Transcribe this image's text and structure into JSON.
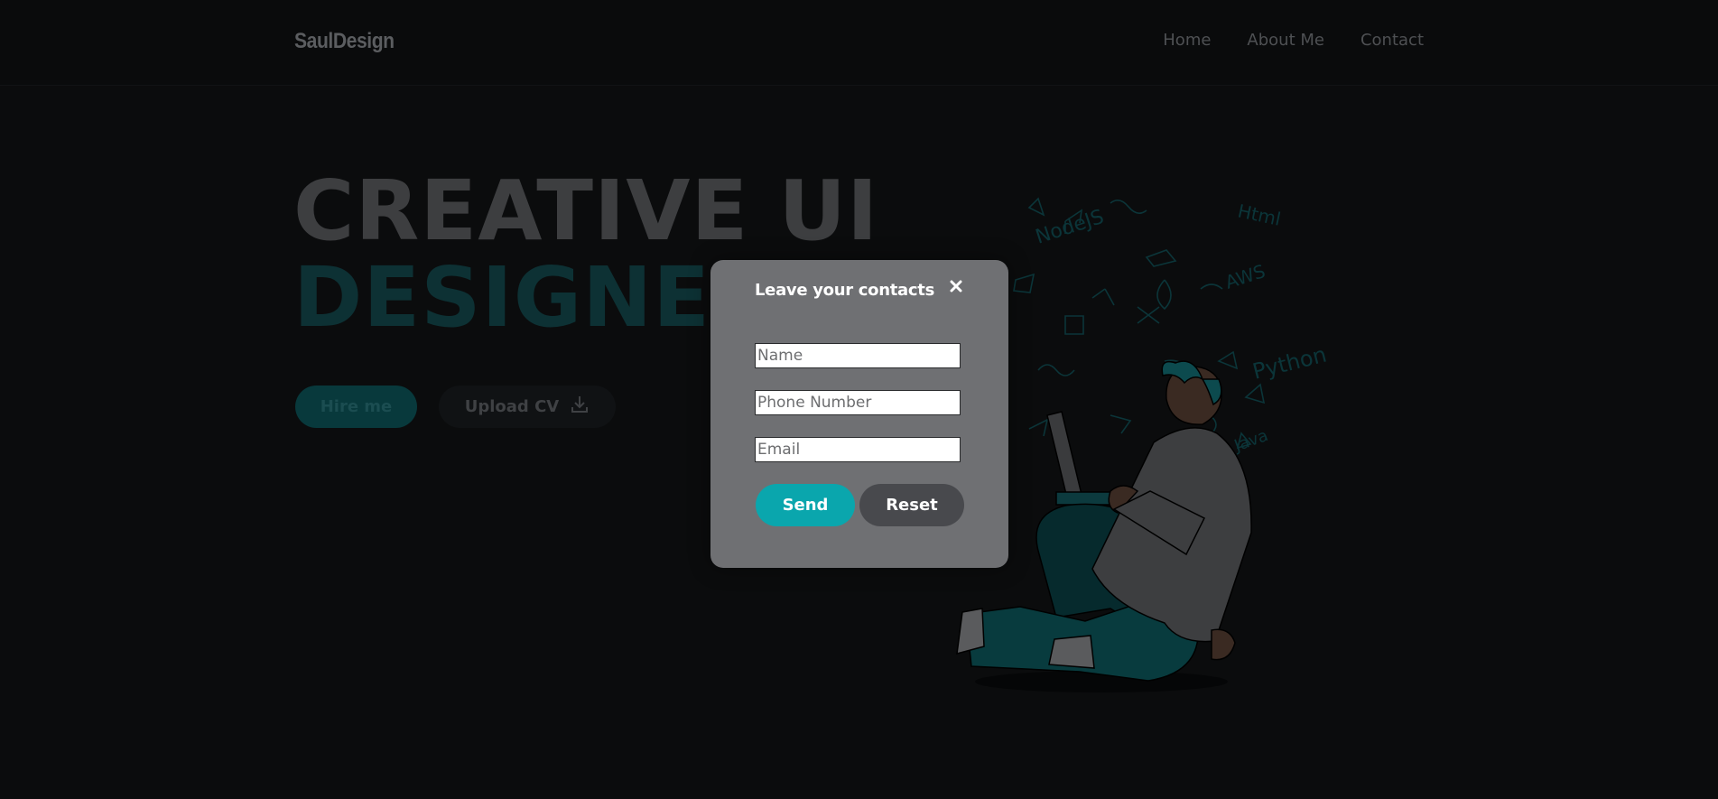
{
  "header": {
    "logo": "SaulDesign",
    "nav": [
      "Home",
      "About Me",
      "Contact"
    ]
  },
  "hero": {
    "line1": "CREATIVE UI",
    "line2": "DESIGNER",
    "hire_label": "Hire me",
    "upload_label": "Upload CV",
    "upload_icon": "download-icon"
  },
  "modal": {
    "title": "Leave your contacts",
    "close_icon": "close-icon",
    "name_placeholder": "Name",
    "phone_placeholder": "Phone Number",
    "email_placeholder": "Email",
    "send_label": "Send",
    "reset_label": "Reset"
  },
  "illustration": {
    "doodles": [
      "NodeJS",
      "Html",
      "AWS",
      "Python",
      "Java"
    ]
  },
  "colors": {
    "accent": "#0aa6ad",
    "dark_teal": "#08393c",
    "modal_bg": "#6f7073",
    "page_bg": "#0b0c0d"
  }
}
